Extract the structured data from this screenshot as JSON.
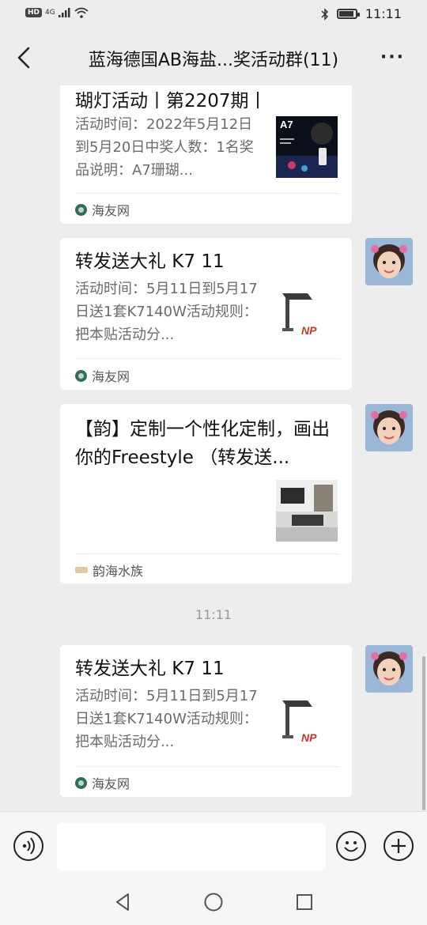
{
  "status_bar": {
    "network_badge": "HD",
    "network_type": "4G",
    "time": "11:11"
  },
  "header": {
    "title": "蓝海德国AB海盐...奖活动群(11)",
    "more_label": "···"
  },
  "messages": [
    {
      "title": "瑚灯活动丨第2207期丨",
      "desc": "活动时间：2022年5月12日到5月20日中奖人数：1名奖品说明：A7珊瑚...",
      "source": "海友网",
      "thumb_text": "A7"
    },
    {
      "title": "转发送大礼 K7 11",
      "desc": "活动时间：5月11日到5月17日送1套K7140W活动规则：把本贴活动分...",
      "source": "海友网",
      "thumb_text": "NP"
    },
    {
      "title": "【韵】定制一个性化定制，画出你的Freestyle （转发送...",
      "source": "韵海水族"
    },
    {
      "title": "转发送大礼 K7 11",
      "desc": "活动时间：5月11日到5月17日送1套K7140W活动规则：把本贴活动分...",
      "source": "海友网",
      "thumb_text": "NP"
    }
  ],
  "timestamp": "11:11",
  "input_bar": {
    "message_value": ""
  },
  "icons": [
    "back-icon",
    "more-icon",
    "voice-icon",
    "emoji-icon",
    "plus-icon",
    "nav-back-icon",
    "nav-home-icon",
    "nav-recents-icon"
  ]
}
